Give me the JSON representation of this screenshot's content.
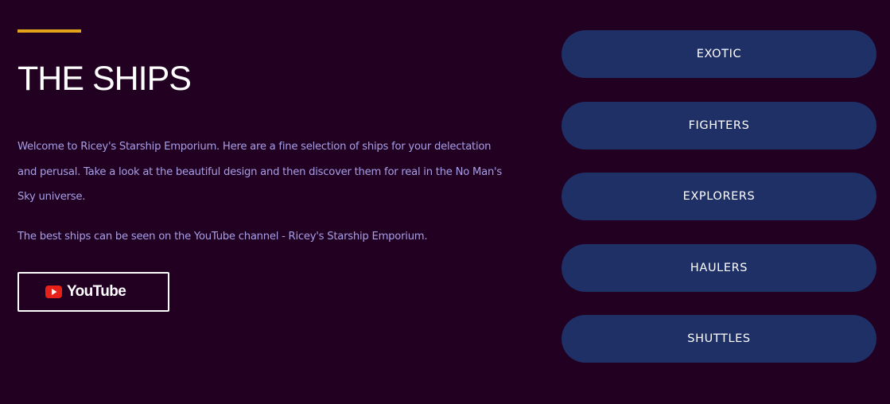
{
  "section": {
    "title": "THE SHIPS",
    "intro": "Welcome to Ricey's Starship Emporium. Here are a fine selection of ships for your delectation and perusal. Take a look at the beautiful design and then discover them for real in the No Man's Sky universe.",
    "channel_note": "The best ships can be seen on the YouTube channel - Ricey's Starship Emporium."
  },
  "youtube_button": {
    "label": "YouTube",
    "icon": "youtube-play-icon"
  },
  "categories": [
    {
      "label": "EXOTIC"
    },
    {
      "label": "FIGHTERS"
    },
    {
      "label": "EXPLORERS"
    },
    {
      "label": "HAULERS"
    },
    {
      "label": "SHUTTLES"
    }
  ],
  "colors": {
    "background": "#210022",
    "accent": "#e3a31b",
    "body_text": "#a79fe6",
    "category_button": "#1f3066",
    "youtube_red": "#e62117"
  }
}
